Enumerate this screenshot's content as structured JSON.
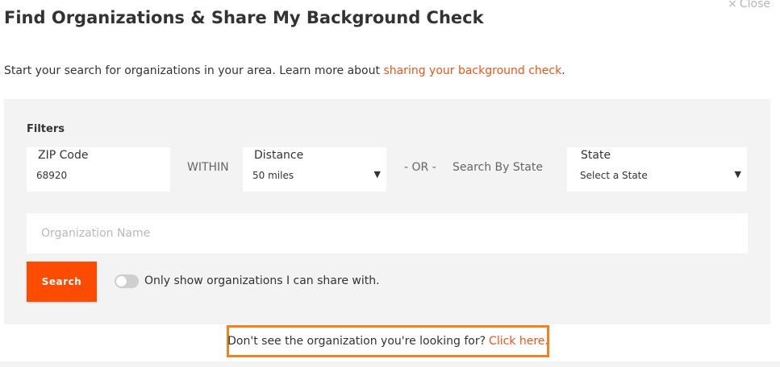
{
  "dialog": {
    "title": "Find Organizations & Share My Background Check",
    "close_label": "Close"
  },
  "intro": {
    "text": "Start your search for organizations in your area. Learn more about ",
    "link_text": "sharing your background check",
    "suffix": "."
  },
  "filters": {
    "heading": "Filters",
    "zip": {
      "label": "ZIP Code",
      "value": "68920"
    },
    "within_label": "WITHIN",
    "distance": {
      "label": "Distance",
      "value": "50 miles"
    },
    "or_label": "- OR -",
    "search_by_state_label": "Search By State",
    "state": {
      "label": "State",
      "value": "Select a State"
    },
    "organization_name": {
      "placeholder": "Organization Name",
      "value": ""
    },
    "search_button": "Search",
    "share_toggle": {
      "label": "Only show organizations I can share with.",
      "on": false
    }
  },
  "footer": {
    "prompt": "Don't see the organization you're looking for?",
    "link_text": "Click here."
  },
  "colors": {
    "accent": "#fc4c02",
    "link": "#e8571c",
    "highlight_border": "#f28120",
    "panel_bg": "#f3f3f3"
  },
  "icons": {
    "close": "close-icon",
    "dropdown": "caret-down-icon"
  }
}
